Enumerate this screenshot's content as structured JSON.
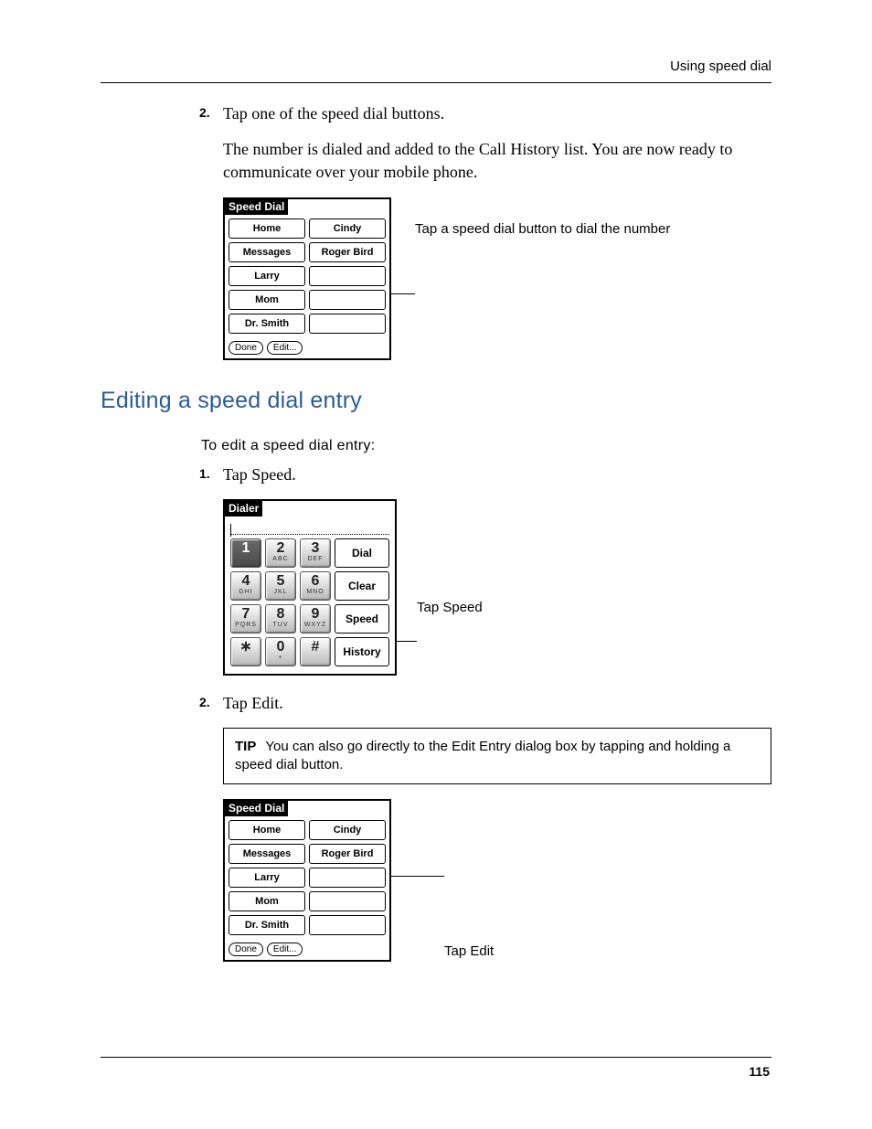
{
  "runningHead": "Using speed dial",
  "pageNumber": "115",
  "stepA": {
    "marker": "2.",
    "line1": "Tap one of the speed dial buttons.",
    "line2": "The number is dialed and added to the Call History list. You are now ready to communicate over your mobile phone."
  },
  "speedDial": {
    "title": "Speed Dial",
    "rows": [
      [
        "Home",
        "Cindy"
      ],
      [
        "Messages",
        "Roger Bird"
      ],
      [
        "Larry",
        ""
      ],
      [
        "Mom",
        ""
      ],
      [
        "Dr. Smith",
        ""
      ]
    ],
    "footer": {
      "done": "Done",
      "edit": "Edit..."
    }
  },
  "callout1": "Tap a speed dial button to dial the number",
  "heading2": "Editing a speed dial entry",
  "procHeading": "To edit a speed dial entry:",
  "stepB": {
    "marker": "1.",
    "text": "Tap Speed."
  },
  "dialer": {
    "title": "Dialer",
    "rows": [
      [
        {
          "big": "1",
          "sub": ""
        },
        {
          "big": "2",
          "sub": "ABC"
        },
        {
          "big": "3",
          "sub": "DEF"
        }
      ],
      [
        {
          "big": "4",
          "sub": "GHI"
        },
        {
          "big": "5",
          "sub": "JKL"
        },
        {
          "big": "6",
          "sub": "MNO"
        }
      ],
      [
        {
          "big": "7",
          "sub": "PQRS"
        },
        {
          "big": "8",
          "sub": "TUV"
        },
        {
          "big": "9",
          "sub": "WXYZ"
        }
      ],
      [
        {
          "big": "∗",
          "sub": ""
        },
        {
          "big": "0",
          "sub": "+"
        },
        {
          "big": "#",
          "sub": ""
        }
      ]
    ],
    "side": [
      "Dial",
      "Clear",
      "Speed",
      "History"
    ]
  },
  "callout2": "Tap Speed",
  "stepC": {
    "marker": "2.",
    "text": "Tap Edit."
  },
  "tip": {
    "label": "TIP",
    "text": "You can also go directly to the Edit Entry dialog box by tapping and holding a speed dial button."
  },
  "callout3": "Tap Edit"
}
